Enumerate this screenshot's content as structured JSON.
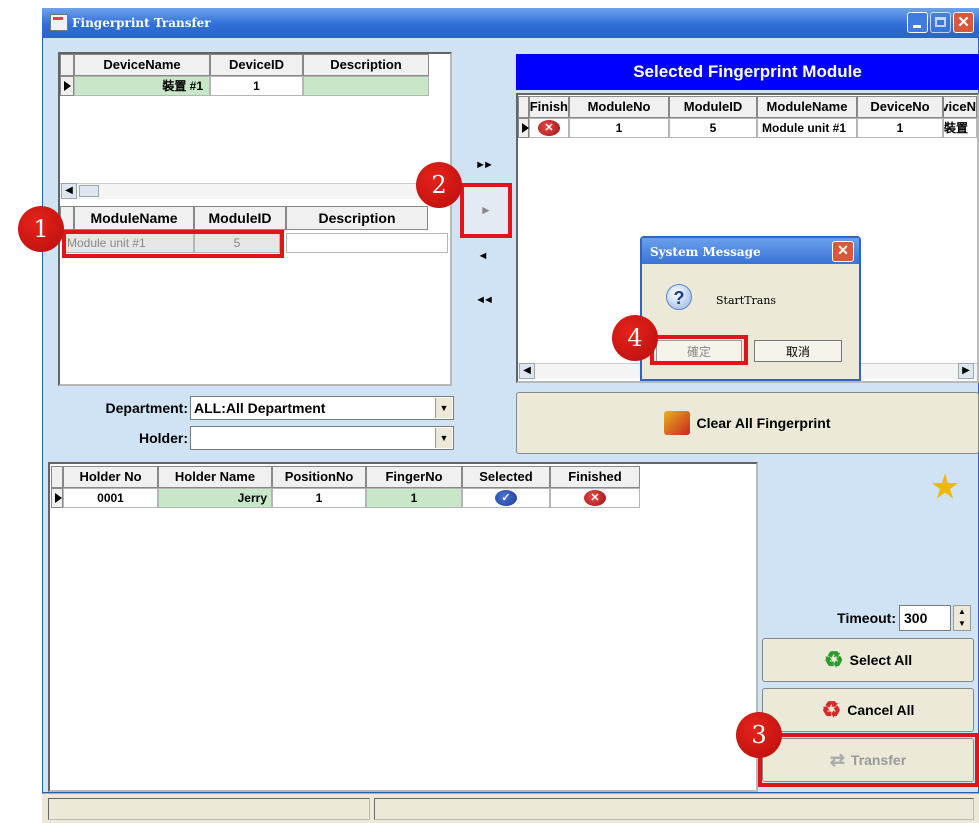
{
  "window": {
    "title": "Fingerprint Transfer"
  },
  "device_table": {
    "headers": [
      "DeviceName",
      "DeviceID",
      "Description"
    ],
    "rows": [
      {
        "name": "裝置 #1",
        "id": "1",
        "description": ""
      }
    ]
  },
  "module_table": {
    "headers": [
      "ModuleName",
      "ModuleID",
      "Description"
    ],
    "rows": [
      {
        "name": "Module unit #1",
        "id": "5",
        "description": ""
      }
    ]
  },
  "move_buttons": {
    "move_all_right": "►►",
    "move_right": "►",
    "move_left": "◄",
    "move_all_left": "◄◄"
  },
  "selected_panel": {
    "title": "Selected Fingerprint Module",
    "headers": [
      "Finish",
      "ModuleNo",
      "ModuleID",
      "ModuleName",
      "DeviceNo",
      "DeviceN"
    ],
    "rows": [
      {
        "finish_icon": "error-x-icon",
        "module_no": "1",
        "module_id": "5",
        "module_name": "Module unit #1",
        "device_no": "1",
        "device_name": "裝置"
      }
    ]
  },
  "dialog": {
    "title": "System Message",
    "message": "StartTrans",
    "ok": "確定",
    "cancel": "取消"
  },
  "filters": {
    "department_label": "Department:",
    "department_value": "ALL:All Department",
    "holder_label": "Holder:",
    "holder_value": ""
  },
  "clear_button": "Clear All Fingerprint",
  "holder_table": {
    "headers": [
      "Holder No",
      "Holder Name",
      "PositionNo",
      "FingerNo",
      "Selected",
      "Finished"
    ],
    "rows": [
      {
        "holder_no": "0001",
        "holder_name": "Jerry",
        "position_no": "1",
        "finger_no": "1",
        "selected_icon": "check-icon",
        "finished_icon": "error-x-icon"
      }
    ]
  },
  "timeout": {
    "label": "Timeout:",
    "value": "300"
  },
  "actions": {
    "select_all": "Select All",
    "cancel_all": "Cancel All",
    "transfer": "Transfer"
  },
  "callouts": [
    "1",
    "2",
    "3",
    "4"
  ],
  "colors": {
    "title_blue": "#0000ff",
    "highlight_red": "#e0141a",
    "row_green": "#c8e6c8"
  }
}
